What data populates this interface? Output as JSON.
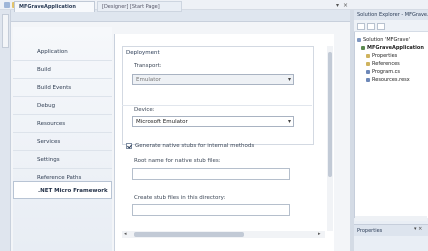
{
  "doc_tabs": [
    {
      "label": "MFGraveApplication",
      "active": true
    },
    {
      "label": "[Designer] [Start Page]",
      "active": false
    }
  ],
  "tab_controls": {
    "pin": "▾",
    "close": "×"
  },
  "nav": {
    "items": [
      "Application",
      "Build",
      "Build Events",
      "Debug",
      "Resources",
      "Services",
      "Settings",
      "Reference Paths",
      ".NET Micro Framework"
    ],
    "selected_index": 8
  },
  "deployment": {
    "group_label": "Deployment",
    "transport_label": "Transport:",
    "transport_value": "Emulator",
    "device_label": "Device:",
    "device_value": "Microsoft Emulator",
    "checkbox_checked": true,
    "checkbox_label": "Generate native stubs for internal methods",
    "root_name_label": "Root name for native stub files:",
    "root_name_value": "",
    "create_stub_label": "Create stub files in this directory:",
    "create_stub_value": ""
  },
  "solution_explorer": {
    "title": "Solution Explorer - MFGrave...",
    "tree": [
      {
        "text": "Solution 'MFGrave'",
        "level": 0
      },
      {
        "text": "MFGraveApplication",
        "level": 1
      },
      {
        "text": "Properties",
        "level": 2
      },
      {
        "text": "References",
        "level": 2
      },
      {
        "text": "Program.cs",
        "level": 2
      },
      {
        "text": "Resources.resx",
        "level": 2
      }
    ]
  },
  "properties_bar": {
    "label": "Properties",
    "controls": "▾ ×"
  }
}
